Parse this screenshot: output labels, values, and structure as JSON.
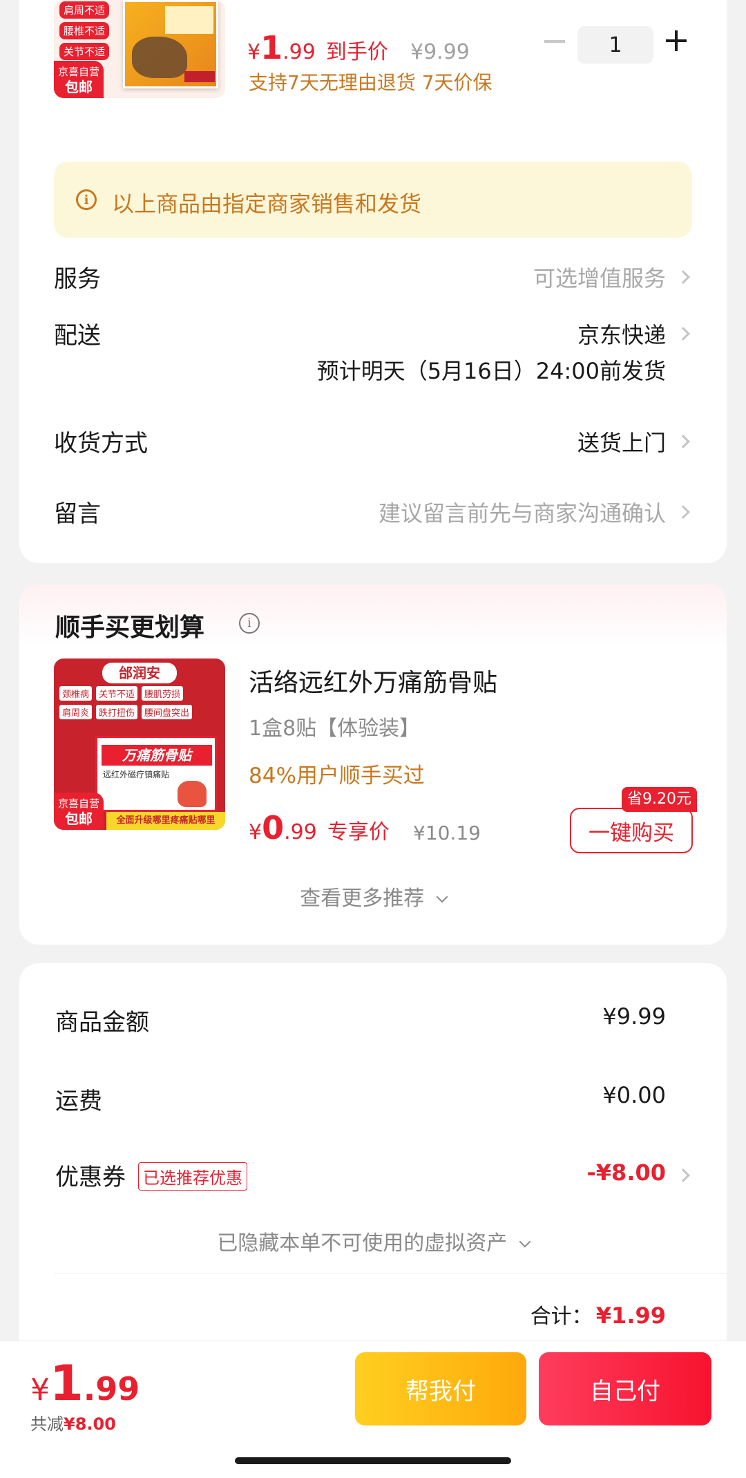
{
  "product": {
    "badges": [
      "肩周不适",
      "腰椎不适",
      "关节不适"
    ],
    "jd_tag_top": "京喜自营",
    "jd_tag_bottom": "包邮",
    "price_int": "1",
    "price_dec": ".99",
    "price_label": "到手价",
    "original_price": "¥9.99",
    "quantity": "1",
    "service_note": "支持7天无理由退货 7天价保"
  },
  "notice": {
    "text": "以上商品由指定商家销售和发货"
  },
  "order_options": {
    "service_label": "服务",
    "service_value": "可选增值服务",
    "delivery_label": "配送",
    "delivery_value": "京东快递",
    "delivery_eta": "预计明天（5月16日）24:00前发货",
    "receive_label": "收货方式",
    "receive_value": "送货上门",
    "message_label": "留言",
    "message_placeholder": "建议留言前先与商家沟通确认"
  },
  "recommend": {
    "title": "顺手买更划算",
    "item_brand": "邰润安",
    "item_tags": [
      "颈椎病",
      "关节不适",
      "腰肌劳损",
      "肩周炎",
      "跌打扭伤",
      "腰间盘突出"
    ],
    "item_box_text": "万痛筋骨贴",
    "item_box_sub": "远红外磁疗镇痛贴",
    "item_ribbon": "全面升级哪里疼痛贴哪里",
    "jd_tag_top": "京喜自营",
    "jd_tag_bottom": "包邮",
    "item_name": "活络远红外万痛筋骨贴",
    "item_spec": "1盒8贴【体验装】",
    "item_social": "84%用户顺手买过",
    "item_price_int": "0",
    "item_price_dec": ".99",
    "item_price_label": "专享价",
    "item_original_price": "¥10.19",
    "save_badge": "省9.20元",
    "buy_button": "一键购买",
    "more": "查看更多推荐"
  },
  "summary": {
    "goods_label": "商品金额",
    "goods_value": "¥9.99",
    "shipping_label": "运费",
    "shipping_value": "¥0.00",
    "coupon_label": "优惠券",
    "coupon_tag": "已选推荐优惠",
    "coupon_value": "-¥8.00",
    "hidden_assets": "已隐藏本单不可使用的虚拟资产",
    "total_label": "合计：",
    "total_value": "¥1.99"
  },
  "bottom": {
    "currency": "¥",
    "price_int": "1",
    "price_dec": ".99",
    "discount_label": "共减",
    "discount_value": "¥8.00",
    "help_pay": "帮我付",
    "self_pay": "自己付"
  },
  "colors": {
    "accent_red": "#e8202f",
    "orange_text": "#c9781f",
    "notice_bg": "#fdf7d9",
    "help_pay_start": "#ffcf1f",
    "help_pay_end": "#ffa90c",
    "self_pay_start": "#ff3c5c",
    "self_pay_end": "#f7132f"
  }
}
